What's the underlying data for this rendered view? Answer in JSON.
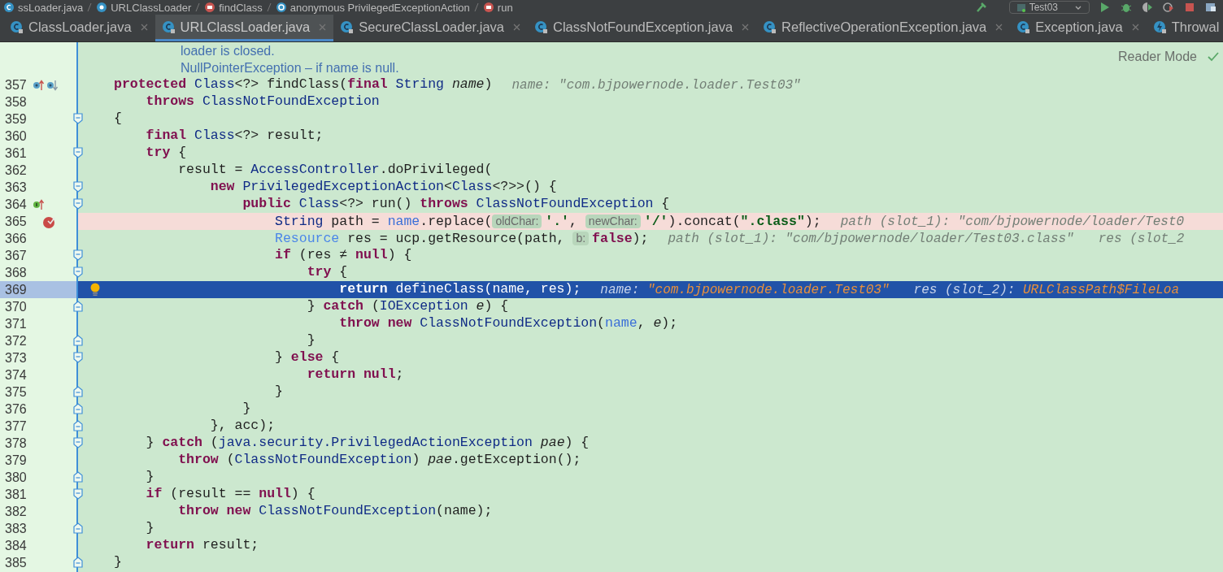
{
  "breadcrumb": [
    {
      "kind": "file",
      "label": "ssLoader.java"
    },
    {
      "kind": "class",
      "label": "URLClassLoader"
    },
    {
      "kind": "method",
      "label": "findClass"
    },
    {
      "kind": "anonymous",
      "label": "anonymous PrivilegedExceptionAction"
    },
    {
      "kind": "method",
      "label": "run"
    }
  ],
  "run_config": {
    "label": "Test03"
  },
  "tabs": [
    {
      "kind": "class",
      "label": "ClassLoader.java",
      "selected": false
    },
    {
      "kind": "class",
      "label": "URLClassLoader.java",
      "selected": true
    },
    {
      "kind": "class",
      "label": "SecureClassLoader.java",
      "selected": false
    },
    {
      "kind": "class",
      "label": "ClassNotFoundException.java",
      "selected": false
    },
    {
      "kind": "class",
      "label": "ReflectiveOperationException.java",
      "selected": false
    },
    {
      "kind": "class",
      "label": "Exception.java",
      "selected": false
    },
    {
      "kind": "throwable",
      "label": "Throwal",
      "selected": false
    }
  ],
  "reader_mode": {
    "label": "Reader Mode"
  },
  "doc_lines": [
    "loader is closed.",
    "NullPointerException – if name is null."
  ],
  "lines": [
    {
      "number": "357",
      "icons": [
        {
          "kind": "overriding"
        },
        {
          "kind": "implemented"
        }
      ],
      "tokens": [
        {
          "kind": "kw",
          "text": "protected "
        },
        {
          "kind": "type",
          "text": "Class"
        },
        {
          "kind": "plain",
          "text": "<?> findClass("
        },
        {
          "kind": "kw",
          "text": "final "
        },
        {
          "kind": "type",
          "text": "String "
        },
        {
          "kind": "param",
          "text": "name"
        },
        {
          "kind": "plain",
          "text": ")"
        }
      ],
      "debug": [
        {
          "label": "name: ",
          "value": "\"com.bjpowernode.loader.Test03\""
        }
      ]
    },
    {
      "number": "358",
      "tokens": [
        {
          "kind": "kw",
          "text": "    throws "
        },
        {
          "kind": "type",
          "text": "ClassNotFoundException"
        }
      ]
    },
    {
      "number": "359",
      "fold_start": true,
      "tokens": [
        {
          "kind": "plain",
          "text": "{"
        }
      ]
    },
    {
      "number": "360",
      "tokens": [
        {
          "kind": "kw",
          "text": "    final "
        },
        {
          "kind": "type",
          "text": "Class"
        },
        {
          "kind": "plain",
          "text": "<?> result;"
        }
      ]
    },
    {
      "number": "361",
      "fold_start": true,
      "tokens": [
        {
          "kind": "kw",
          "text": "    try "
        },
        {
          "kind": "plain",
          "text": "{"
        }
      ]
    },
    {
      "number": "362",
      "tokens": [
        {
          "kind": "plain",
          "text": "        result = "
        },
        {
          "kind": "type",
          "text": "AccessController"
        },
        {
          "kind": "plain",
          "text": ".doPrivileged("
        }
      ]
    },
    {
      "number": "363",
      "fold_start": true,
      "tokens": [
        {
          "kind": "kw",
          "text": "            new "
        },
        {
          "kind": "type",
          "text": "PrivilegedExceptionAction"
        },
        {
          "kind": "plain",
          "text": "<"
        },
        {
          "kind": "type",
          "text": "Class"
        },
        {
          "kind": "plain",
          "text": "<?>>() {"
        }
      ]
    },
    {
      "number": "364",
      "icons": [
        {
          "kind": "implementing"
        }
      ],
      "fold_start": true,
      "tokens": [
        {
          "kind": "kw",
          "text": "                public "
        },
        {
          "kind": "type",
          "text": "Class"
        },
        {
          "kind": "plain",
          "text": "<?> run() "
        },
        {
          "kind": "kw",
          "text": "throws "
        },
        {
          "kind": "type",
          "text": "ClassNotFoundException"
        },
        {
          "kind": "plain",
          "text": " {"
        }
      ]
    },
    {
      "number": "365",
      "icons": [
        {
          "kind": "breakpoint"
        }
      ],
      "breakpoint": true,
      "tokens": [
        {
          "kind": "type",
          "text": "                    String "
        },
        {
          "kind": "plain",
          "text": "path = "
        },
        {
          "kind": "field",
          "text": "name"
        },
        {
          "kind": "plain",
          "text": ".replace("
        },
        {
          "kind": "hint",
          "text": "oldChar:"
        },
        {
          "kind": "str",
          "text": "'.'"
        },
        {
          "kind": "plain",
          "text": ", "
        },
        {
          "kind": "hint",
          "text": "newChar:"
        },
        {
          "kind": "str",
          "text": "'/'"
        },
        {
          "kind": "plain",
          "text": ").concat("
        },
        {
          "kind": "str",
          "text": "\".class\""
        },
        {
          "kind": "plain",
          "text": ");"
        }
      ],
      "debug": [
        {
          "label": "path (slot_1): ",
          "value": "\"com/bjpowernode/loader/Test0"
        }
      ]
    },
    {
      "number": "366",
      "tokens": [
        {
          "kind": "ltype",
          "text": "                    Resource "
        },
        {
          "kind": "plain",
          "text": "res = ucp.getResource(path, "
        },
        {
          "kind": "hint",
          "text": "b:"
        },
        {
          "kind": "kw",
          "text": "false"
        },
        {
          "kind": "plain",
          "text": ");"
        }
      ],
      "debug": [
        {
          "label": "path (slot_1): ",
          "value": "\"com/bjpowernode/loader/Test03.class\""
        },
        {
          "label": "res (slot_2"
        }
      ]
    },
    {
      "number": "367",
      "fold_start": true,
      "tokens": [
        {
          "kind": "kw",
          "text": "                    if "
        },
        {
          "kind": "plain",
          "text": "(res ≠ "
        },
        {
          "kind": "kw",
          "text": "null"
        },
        {
          "kind": "plain",
          "text": ") {"
        }
      ]
    },
    {
      "number": "368",
      "fold_start": true,
      "tokens": [
        {
          "kind": "kw",
          "text": "                        try "
        },
        {
          "kind": "plain",
          "text": "{"
        }
      ]
    },
    {
      "number": "369",
      "icons": [
        {
          "kind": "bulb"
        }
      ],
      "current": true,
      "tokens": [
        {
          "kind": "kw",
          "text": "                            return "
        },
        {
          "kind": "plain",
          "text": "defineClass("
        },
        {
          "kind": "field",
          "text": "name"
        },
        {
          "kind": "plain",
          "text": ", res);"
        }
      ],
      "debug": [
        {
          "label": "name: ",
          "value": "\"com.bjpowernode.loader.Test03\""
        },
        {
          "label": "res (slot_2): ",
          "value": "URLClassPath$FileLoa"
        }
      ]
    },
    {
      "number": "370",
      "fold_end": true,
      "tokens": [
        {
          "kind": "plain",
          "text": "                        } "
        },
        {
          "kind": "kw",
          "text": "catch "
        },
        {
          "kind": "plain",
          "text": "("
        },
        {
          "kind": "type",
          "text": "IOException "
        },
        {
          "kind": "param",
          "text": "e"
        },
        {
          "kind": "plain",
          "text": ") {"
        }
      ]
    },
    {
      "number": "371",
      "tokens": [
        {
          "kind": "kw",
          "text": "                            throw new "
        },
        {
          "kind": "type",
          "text": "ClassNotFoundException"
        },
        {
          "kind": "plain",
          "text": "("
        },
        {
          "kind": "field",
          "text": "name"
        },
        {
          "kind": "plain",
          "text": ", "
        },
        {
          "kind": "param",
          "text": "e"
        },
        {
          "kind": "plain",
          "text": ");"
        }
      ]
    },
    {
      "number": "372",
      "fold_end": true,
      "tokens": [
        {
          "kind": "plain",
          "text": "                        }"
        }
      ]
    },
    {
      "number": "373",
      "fold_start": true,
      "tokens": [
        {
          "kind": "plain",
          "text": "                    } "
        },
        {
          "kind": "kw",
          "text": "else "
        },
        {
          "kind": "plain",
          "text": "{"
        }
      ]
    },
    {
      "number": "374",
      "tokens": [
        {
          "kind": "kw",
          "text": "                        return null"
        },
        {
          "kind": "plain",
          "text": ";"
        }
      ]
    },
    {
      "number": "375",
      "fold_end": true,
      "tokens": [
        {
          "kind": "plain",
          "text": "                    }"
        }
      ]
    },
    {
      "number": "376",
      "fold_end": true,
      "tokens": [
        {
          "kind": "plain",
          "text": "                }"
        }
      ]
    },
    {
      "number": "377",
      "fold_end": true,
      "tokens": [
        {
          "kind": "plain",
          "text": "            }, acc);"
        }
      ]
    },
    {
      "number": "378",
      "fold_start": true,
      "tokens": [
        {
          "kind": "plain",
          "text": "    } "
        },
        {
          "kind": "kw",
          "text": "catch "
        },
        {
          "kind": "plain",
          "text": "("
        },
        {
          "kind": "type",
          "text": "java.security.PrivilegedActionException "
        },
        {
          "kind": "param",
          "text": "pae"
        },
        {
          "kind": "plain",
          "text": ") {"
        }
      ]
    },
    {
      "number": "379",
      "tokens": [
        {
          "kind": "kw",
          "text": "        throw "
        },
        {
          "kind": "plain",
          "text": "("
        },
        {
          "kind": "type",
          "text": "ClassNotFoundException"
        },
        {
          "kind": "plain",
          "text": ") "
        },
        {
          "kind": "param",
          "text": "pae"
        },
        {
          "kind": "plain",
          "text": ".getException();"
        }
      ]
    },
    {
      "number": "380",
      "fold_end": true,
      "tokens": [
        {
          "kind": "plain",
          "text": "    }"
        }
      ]
    },
    {
      "number": "381",
      "fold_start": true,
      "tokens": [
        {
          "kind": "kw",
          "text": "    if "
        },
        {
          "kind": "plain",
          "text": "(result == "
        },
        {
          "kind": "kw",
          "text": "null"
        },
        {
          "kind": "plain",
          "text": ") {"
        }
      ]
    },
    {
      "number": "382",
      "tokens": [
        {
          "kind": "kw",
          "text": "        throw new "
        },
        {
          "kind": "type",
          "text": "ClassNotFoundException"
        },
        {
          "kind": "plain",
          "text": "(name);"
        }
      ]
    },
    {
      "number": "383",
      "fold_end": true,
      "tokens": [
        {
          "kind": "plain",
          "text": "    }"
        }
      ]
    },
    {
      "number": "384",
      "tokens": [
        {
          "kind": "kw",
          "text": "    return "
        },
        {
          "kind": "plain",
          "text": "result;"
        }
      ]
    },
    {
      "number": "385",
      "fold_end": true,
      "tokens": [
        {
          "kind": "plain",
          "text": "}"
        }
      ]
    }
  ]
}
